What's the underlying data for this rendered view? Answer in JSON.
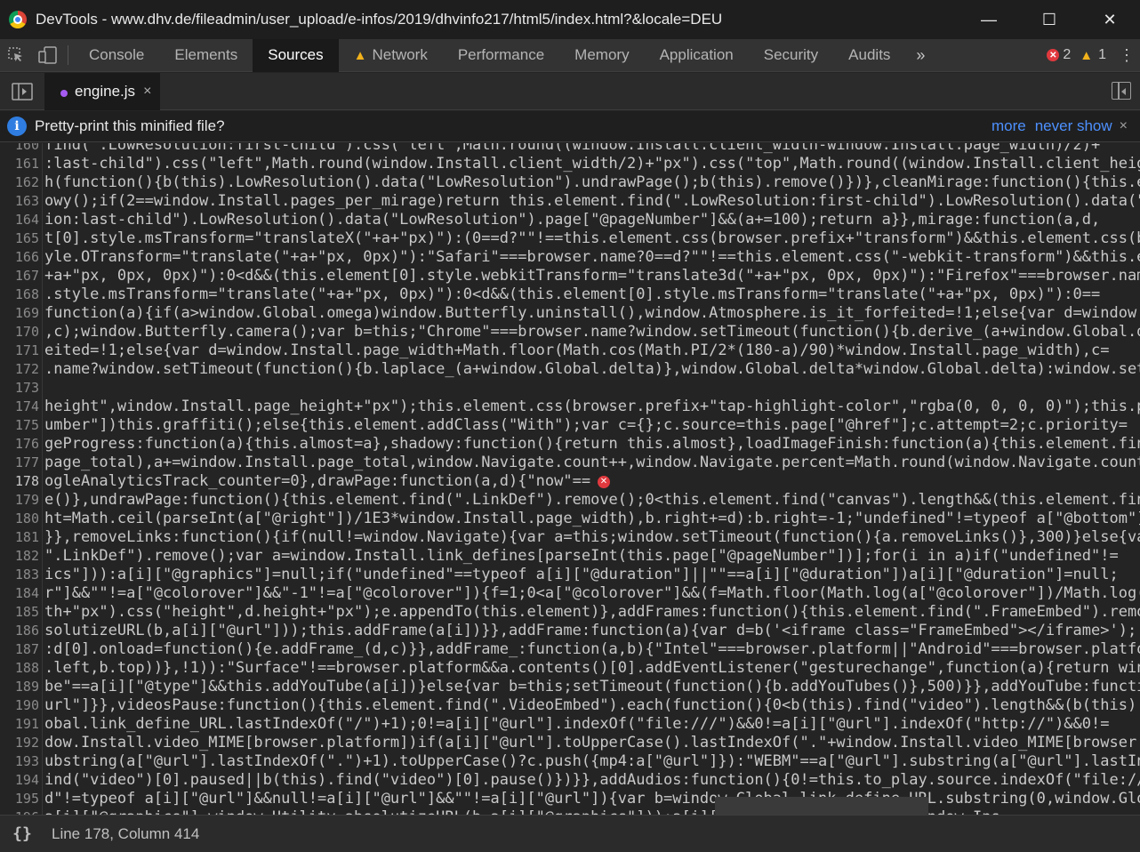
{
  "window": {
    "title": "DevTools - www.dhv.de/fileadmin/user_upload/e-infos/2019/dhvinfo217/html5/index.html?&locale=DEU",
    "minimize": "—",
    "maximize": "☐",
    "close": "✕"
  },
  "toolbar": {
    "tabs": [
      {
        "label": "Console"
      },
      {
        "label": "Elements"
      },
      {
        "label": "Sources"
      },
      {
        "label": "Network"
      },
      {
        "label": "Performance"
      },
      {
        "label": "Memory"
      },
      {
        "label": "Application"
      },
      {
        "label": "Security"
      },
      {
        "label": "Audits"
      }
    ],
    "active_tab": "Sources",
    "more": "»",
    "error_count": "2",
    "warning_count": "1",
    "menu": "⋮"
  },
  "file_tabs": {
    "file_name": "engine.js",
    "close": "×"
  },
  "infobar": {
    "message": "Pretty-print this minified file?",
    "more": "more",
    "never_show": "never show",
    "close": "×"
  },
  "editor": {
    "lines": [
      {
        "num": "160",
        "text": "find(\".LowResolution:first-child\").css(\"left\",Math.round((window.Install.client_width-window.Install.page_width)/2)+"
      },
      {
        "num": "161",
        "text": ":last-child\").css(\"left\",Math.round(window.Install.client_width/2)+\"px\").css(\"top\",Math.round((window.Install.client_height-"
      },
      {
        "num": "162",
        "text": "h(function(){b(this).LowResolution().data(\"LowResolution\").undrawPage();b(this).remove()})},cleanMirage:function(){this.eleme"
      },
      {
        "num": "163",
        "text": "owy();if(2==window.Install.pages_per_mirage)return this.element.find(\".LowResolution:first-child\").LowResolution().data(\"LowR"
      },
      {
        "num": "164",
        "text": "ion:last-child\").LowResolution().data(\"LowResolution\").page[\"@pageNumber\"]&&(a+=100);return a}},mirage:function(a,d,"
      },
      {
        "num": "165",
        "text": "t[0].style.msTransform=\"translateX(\"+a+\"px)\"):(0==d?\"\"!==this.element.css(browser.prefix+\"transform\")&&this.element.css(brows"
      },
      {
        "num": "166",
        "text": "yle.OTransform=\"translate(\"+a+\"px, 0px)\"):\"Safari\"===browser.name?0==d?\"\"!==this.element.css(\"-webkit-transform\")&&this.eleme"
      },
      {
        "num": "167",
        "text": "+a+\"px, 0px, 0px)\"):0<d&&(this.element[0].style.webkitTransform=\"translate3d(\"+a+\"px, 0px, 0px)\"):\"Firefox\"===browser.name?"
      },
      {
        "num": "168",
        "text": ".style.msTransform=\"translate(\"+a+\"px, 0px)\"):0<d&&(this.element[0].style.msTransform=\"translate(\"+a+\"px, 0px)\"):0=="
      },
      {
        "num": "169",
        "text": "function(a){if(a>window.Global.omega)window.Butterfly.uninstall(),window.Atmosphere.is_it_forfeited=!1;else{var d=window.Inst"
      },
      {
        "num": "170",
        "text": ",c);window.Butterfly.camera();var b=this;\"Chrome\"===browser.name?window.setTimeout(function(){b.derive_(a+window.Global.delta"
      },
      {
        "num": "171",
        "text": "eited=!1;else{var d=window.Install.page_width+Math.floor(Math.cos(Math.PI/2*(180-a)/90)*window.Install.page_width),c="
      },
      {
        "num": "172",
        "text": ".name?window.setTimeout(function(){b.laplace_(a+window.Global.delta)},window.Global.delta*window.Global.delta):window.setTime"
      },
      {
        "num": "173",
        "text": ""
      },
      {
        "num": "174",
        "text": "height\",window.Install.page_height+\"px\");this.element.css(browser.prefix+\"tap-highlight-color\",\"rgba(0, 0, 0, 0)\");this.page="
      },
      {
        "num": "175",
        "text": "umber\"])this.graffiti();else{this.element.addClass(\"With\");var c={};c.source=this.page[\"@href\"];c.attempt=2;c.priority="
      },
      {
        "num": "176",
        "text": "geProgress:function(a){this.almost=a},shadowy:function(){return this.almost},loadImageFinish:function(a){this.element.find("
      },
      {
        "num": "177",
        "text": "page_total),a+=window.Install.page_total,window.Navigate.count++,window.Navigate.percent=Math.round(window.Navigate.count/"
      },
      {
        "num": "178",
        "text": "ogleAnalyticsTrack_counter=0},drawPage:function(a,d){\"now\"=="
      },
      {
        "num": "179",
        "text": "e()},undrawPage:function(){this.element.find(\".LinkDef\").remove();0<this.element.find(\"canvas\").length&&(this.element.find(\"c"
      },
      {
        "num": "180",
        "text": "ht=Math.ceil(parseInt(a[\"@right\"])/1E3*window.Install.page_width),b.right+=d):b.right=-1;\"undefined\"!=typeof a[\"@bottom\"]?"
      },
      {
        "num": "181",
        "text": "}},removeLinks:function(){if(null!=window.Navigate){var a=this;window.setTimeout(function(){a.removeLinks()},300)}else{var b="
      },
      {
        "num": "182",
        "text": "\".LinkDef\").remove();var a=window.Install.link_defines[parseInt(this.page[\"@pageNumber\"])];for(i in a)if(\"undefined\"!="
      },
      {
        "num": "183",
        "text": "ics\"])):a[i][\"@graphics\"]=null;if(\"undefined\"==typeof a[i][\"@duration\"]||\"\"==a[i][\"@duration\"])a[i][\"@duration\"]=null;"
      },
      {
        "num": "184",
        "text": "r\"]&&\"\"!=a[\"@colorover\"]&&\"-1\"!=a[\"@colorover\"]){f=1;0<a[\"@colorover\"]&&(f=Math.floor(Math.log(a[\"@colorover\"])/Math.log(16))"
      },
      {
        "num": "185",
        "text": "th+\"px\").css(\"height\",d.height+\"px\");e.appendTo(this.element)},addFrames:function(){this.element.find(\".FrameEmbed\").remove()"
      },
      {
        "num": "186",
        "text": "solutizeURL(b,a[i][\"@url\"]));this.addFrame(a[i])}},addFrame:function(a){var d=b('<iframe class=\"FrameEmbed\"></iframe>');"
      },
      {
        "num": "187",
        "text": ":d[0].onload=function(){e.addFrame_(d,c)}},addFrame_:function(a,b){\"Intel\"===browser.platform||\"Android\"===browser.platform?"
      },
      {
        "num": "188",
        "text": ".left,b.top))},!1)):\"Surface\"!==browser.platform&&a.contents()[0].addEventListener(\"gesturechange\",function(a){return window"
      },
      {
        "num": "189",
        "text": "be\"==a[i][\"@type\"]&&this.addYouTube(a[i])}else{var b=this;setTimeout(function(){b.addYouTubes()},500)}},addYouTube:function(a"
      },
      {
        "num": "190",
        "text": "url\"]}},videosPause:function(){this.element.find(\".VideoEmbed\").each(function(){0<b(this).find(\"video\").length&&(b(this).find"
      },
      {
        "num": "191",
        "text": "obal.link_define_URL.lastIndexOf(\"/\")+1);0!=a[i][\"@url\"].indexOf(\"file:///\")&&0!=a[i][\"@url\"].indexOf(\"http://\")&&0!="
      },
      {
        "num": "192",
        "text": "dow.Install.video_MIME[browser.platform])if(a[i][\"@url\"].toUpperCase().lastIndexOf(\".\"+window.Install.video_MIME[browser.plat"
      },
      {
        "num": "193",
        "text": "ubstring(a[\"@url\"].lastIndexOf(\".\")+1).toUpperCase()?c.push({mp4:a[\"@url\"]}):\"WEBM\"==a[\"@url\"].substring(a[\"@url\"].lastIndex"
      },
      {
        "num": "194",
        "text": "ind(\"video\")[0].paused||b(this).find(\"video\")[0].pause()})}},addAudios:function(){0!=this.to_play.source.indexOf(\"file:///\")&"
      },
      {
        "num": "195",
        "text": "d\"!=typeof a[i][\"@url\"]&&null!=a[i][\"@url\"]&&\"\"!=a[i][\"@url\"]){var b=window.Global.link_define_URL.substring(0,window.Globa"
      },
      {
        "num": "196",
        "text": "a[i][\"@graphics\"]=window.Utility.absolutizeURL(b,a[i][\"@graphics\"]));a[i][\"@url\"]=...;for(i in window.Ins"
      }
    ],
    "current_line": "178",
    "error_marker": "✕"
  },
  "statusbar": {
    "pretty_print": "{}",
    "position": "Line 178, Column 414"
  }
}
